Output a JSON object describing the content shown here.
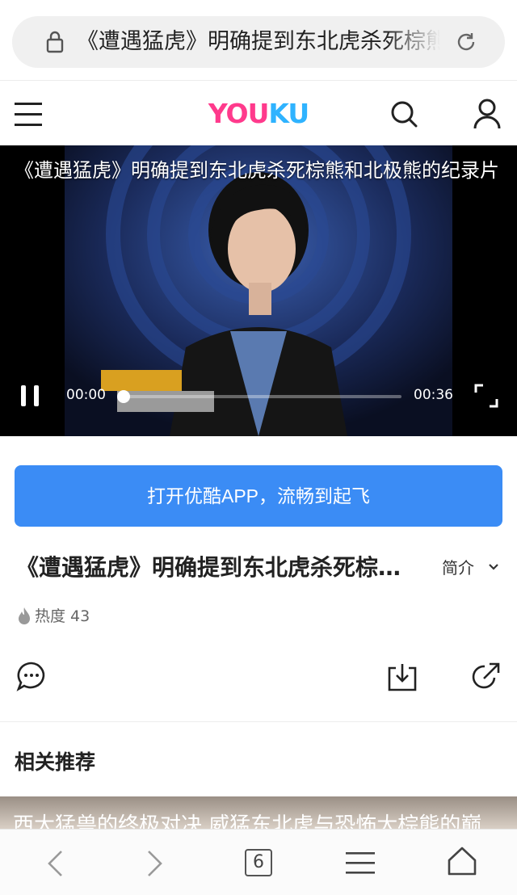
{
  "browser": {
    "url_text": "《遭遇猛虎》明确提到东北虎杀死棕熊和北极熊的纪录片",
    "tab_count": "6"
  },
  "header": {
    "logo_part1": "YOU",
    "logo_part2": "KU"
  },
  "video": {
    "title": "《遭遇猛虎》明确提到东北虎杀死棕熊和北极熊的纪录片",
    "current_time": "00:00",
    "total_time": "00:36",
    "progress": 0
  },
  "open_app": {
    "label": "打开优酷APP，流畅到起飞"
  },
  "info": {
    "title": "《遭遇猛虎》明确提到东北虎杀死棕熊和北极熊的纪录片",
    "intro_label": "简介",
    "heat_label": "热度 43"
  },
  "related": {
    "heading": "相关推荐",
    "first_item_title": "西大猛兽的终极对决 威猛东北虎与恐怖大棕熊的巅"
  },
  "colors": {
    "accent": "#3b8cf5",
    "logo_pink": "#ff3a8c",
    "logo_blue": "#2fb3ff"
  }
}
